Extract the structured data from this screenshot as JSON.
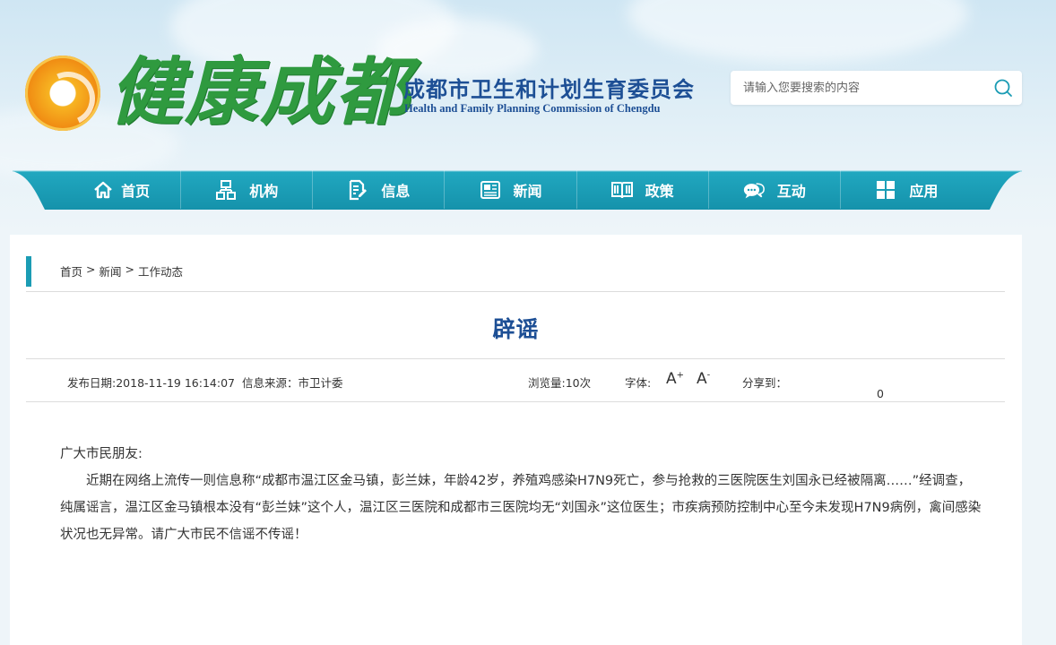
{
  "header": {
    "logo_text": "健康成都",
    "org_name_cn": "成都市卫生和计划生育委员会",
    "org_name_en": "Health and Family Planning Commission of Chengdu",
    "search_placeholder": "请输入您要搜索的内容"
  },
  "nav": {
    "items": [
      {
        "label": "首页",
        "icon": "home-icon"
      },
      {
        "label": "机构",
        "icon": "org-chart-icon"
      },
      {
        "label": "信息",
        "icon": "document-edit-icon"
      },
      {
        "label": "新闻",
        "icon": "newspaper-icon"
      },
      {
        "label": "政策",
        "icon": "book-icon"
      },
      {
        "label": "互动",
        "icon": "chat-icon"
      },
      {
        "label": "应用",
        "icon": "grid-icon"
      }
    ]
  },
  "breadcrumb": {
    "home": "首页",
    "sep": ">",
    "news": "新闻",
    "current": "工作动态"
  },
  "article": {
    "title": "辟谣",
    "publish_date": "发布日期:2018-11-19 16:14:07",
    "source": "信息来源：市卫计委",
    "views": "浏览量:10次",
    "font_label": "字体:",
    "font_increase": "A",
    "font_decrease": "A",
    "share_label": "分享到：",
    "share_count": "0",
    "greeting": "广大市民朋友:",
    "body": "近期在网络上流传一则信息称“成都市温江区金马镇，彭兰妹，年龄42岁，养殖鸡感染H7N9死亡，参与抢救的三医院医生刘国永已经被隔离……”经调查，纯属谣言，温江区金马镇根本没有“彭兰妹”这个人，温江区三医院和成都市三医院均无“刘国永”这位医生；市疾病预防控制中心至今未发现H7N9病例，禽间感染状况也无异常。请广大市民不信谣不传谣！"
  },
  "colors": {
    "nav_teal": "#1b9cb4",
    "title_blue": "#1d4f95",
    "logo_green": "#2f9a3f"
  }
}
